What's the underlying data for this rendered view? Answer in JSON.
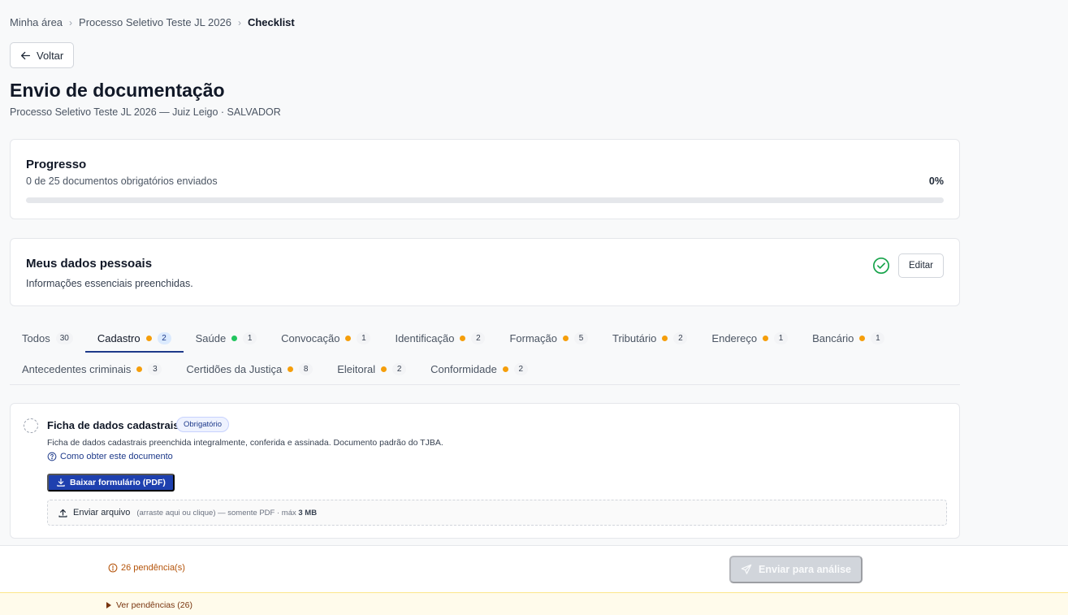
{
  "breadcrumb": {
    "items": [
      "Minha área",
      "Processo Seletivo Teste JL 2026",
      "Checklist"
    ]
  },
  "back_button": {
    "label": "Voltar",
    "icon": "arrow-left-icon"
  },
  "page": {
    "title": "Envio de documentação",
    "subtitle": "Processo Seletivo Teste JL 2026 — Juiz Leigo · SALVADOR"
  },
  "progress": {
    "title": "Progresso",
    "description": "0 de 25 documentos obrigatórios enviados",
    "percent_label": "0%",
    "fraction": 0
  },
  "personal": {
    "title": "Meus dados pessoais",
    "description": "Informações essenciais preenchidas.",
    "status_icon": "check-circle-icon",
    "edit_label": "Editar"
  },
  "tabs": {
    "row1": [
      {
        "label": "Todos",
        "dot": "",
        "count": "30",
        "active": false
      },
      {
        "label": "Cadastro",
        "dot": "orange",
        "count": "2",
        "active": true
      },
      {
        "label": "Saúde",
        "dot": "green",
        "count": "1",
        "active": false
      },
      {
        "label": "Convocação",
        "dot": "orange",
        "count": "1",
        "active": false
      },
      {
        "label": "Identificação",
        "dot": "orange",
        "count": "2",
        "active": false
      },
      {
        "label": "Formação",
        "dot": "orange",
        "count": "5",
        "active": false
      },
      {
        "label": "Tributário",
        "dot": "orange",
        "count": "2",
        "active": false
      },
      {
        "label": "Endereço",
        "dot": "orange",
        "count": "1",
        "active": false
      },
      {
        "label": "Bancário",
        "dot": "orange",
        "count": "1",
        "active": false
      }
    ],
    "row2": [
      {
        "label": "Antecedentes criminais",
        "dot": "orange",
        "count": "3",
        "active": false
      },
      {
        "label": "Certidões da Justiça",
        "dot": "orange",
        "count": "8",
        "active": false
      },
      {
        "label": "Eleitoral",
        "dot": "orange",
        "count": "2",
        "active": false
      },
      {
        "label": "Conformidade",
        "dot": "orange",
        "count": "2",
        "active": false
      }
    ]
  },
  "document": {
    "title": "Ficha de dados cadastrais",
    "badge": "Obrigatório",
    "description": "Ficha de dados cadastrais preenchida integralmente, conferida e assinada. Documento padrão do TJBA.",
    "howto_label": "Como obter este documento",
    "download_label": "Baixar formulário (PDF)",
    "upload_label": "Enviar arquivo",
    "upload_hint": "(arraste aqui ou clique) — somente PDF · máx",
    "upload_max": "3 MB"
  },
  "footer": {
    "pending_label": "26 pendência(s)",
    "send_label": "Enviar para análise",
    "toggle_label": "Ver pendências (26)"
  },
  "colors": {
    "primary": "#1e40af",
    "warning_dot": "#f59e0b",
    "success_dot": "#22c55e",
    "success_icon": "#16a34a",
    "pending_text": "#b45309"
  }
}
